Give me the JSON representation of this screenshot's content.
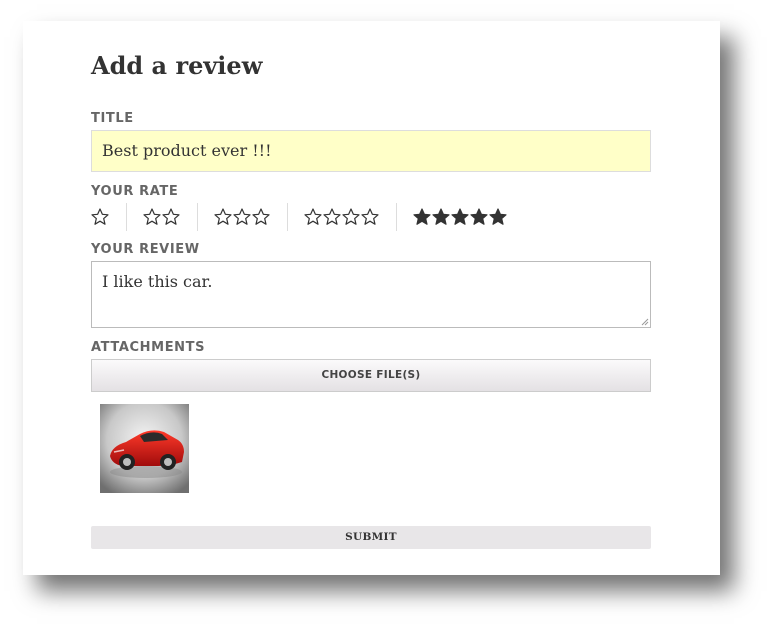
{
  "form": {
    "heading": "Add a review",
    "title_label": "TITLE",
    "title_value": "Best product ever !!!",
    "rate_label": "YOUR RATE",
    "rate_options": [
      1,
      2,
      3,
      4,
      5
    ],
    "selected_rate": 5,
    "review_label": "YOUR REVIEW",
    "review_value": "I like this car.",
    "attachments_label": "ATTACHMENTS",
    "choose_files_label": "CHOOSE FILE(S)",
    "attachment_thumbnail": "red-sports-car-image",
    "submit_label": "SUBMIT"
  },
  "colors": {
    "title_field_bg": "#ffffc8",
    "star": "#333333",
    "label": "#666666"
  }
}
